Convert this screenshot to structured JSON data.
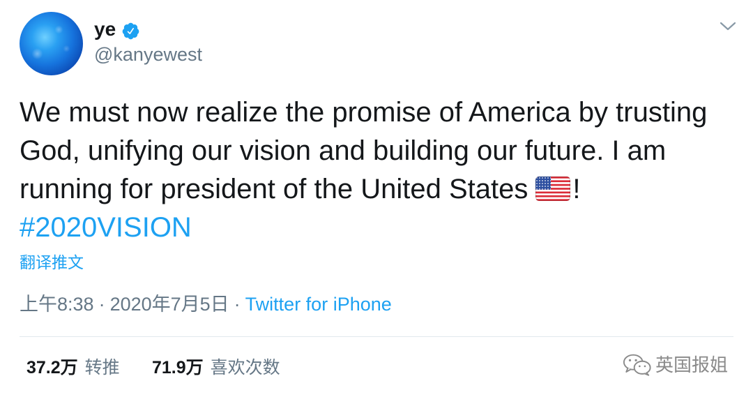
{
  "colors": {
    "accent": "#1DA1F2",
    "text": "#14171A",
    "secondary": "#657786",
    "divider": "#E1E8ED"
  },
  "author": {
    "avatar_icon": "globe-avatar",
    "display_name": "ye",
    "verified_icon": "verified-badge-icon",
    "handle": "@kanyewest"
  },
  "menu": {
    "icon": "chevron-down-icon"
  },
  "tweet": {
    "lines": [
      "We must now realize the promise of America by trusting",
      "God, unifying our vision and building our future. I am",
      "running for president of the United States"
    ],
    "emoji_icon": "us-flag-emoji",
    "after_emoji": "!",
    "hashtag": "#2020VISION",
    "translate_label": "翻译推文"
  },
  "meta": {
    "time": "上午8:38",
    "separator": "·",
    "date": "2020年7月5日",
    "source": "Twitter for iPhone"
  },
  "stats": {
    "retweets_count": "37.2万",
    "retweets_label": "转推",
    "likes_count": "71.9万",
    "likes_label": "喜欢次数"
  },
  "watermark": {
    "icon": "wechat-icon",
    "text": "英国报姐"
  }
}
